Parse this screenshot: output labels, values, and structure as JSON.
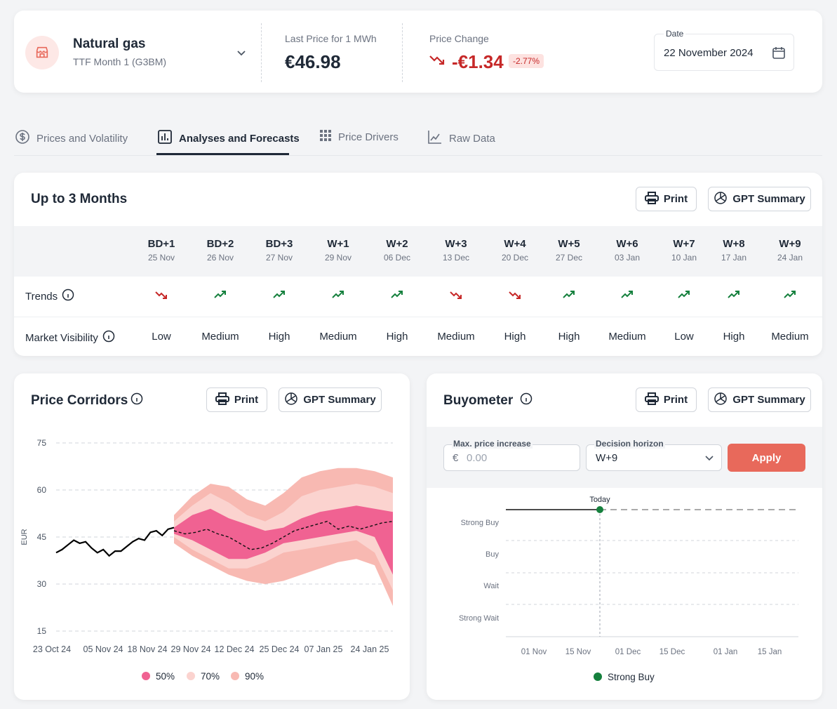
{
  "header": {
    "product_name": "Natural gas",
    "product_sub": "TTF Month 1 (G3BM)",
    "last_price_label": "Last Price for 1 MWh",
    "last_price_value": "€46.98",
    "price_change_label": "Price Change",
    "price_change_value": "-€1.34",
    "price_change_pct": "-2.77%",
    "date_label": "Date",
    "date_value": "22 November 2024"
  },
  "tabs": [
    {
      "label": "Prices and Volatility",
      "icon": "dollar-circle-icon"
    },
    {
      "label": "Analyses and Forecasts",
      "icon": "bar-chart-icon"
    },
    {
      "label": "Price Drivers",
      "icon": "grid-icon"
    },
    {
      "label": "Raw Data",
      "icon": "chart-line-icon"
    }
  ],
  "buttons": {
    "print": "Print",
    "gpt": "GPT Summary"
  },
  "months": {
    "title": "Up to 3 Months",
    "trends_label": "Trends",
    "visibility_label": "Market Visibility",
    "columns": [
      {
        "h": "BD+1",
        "d": "25 Nov",
        "trend": "down",
        "vis": "Low"
      },
      {
        "h": "BD+2",
        "d": "26 Nov",
        "trend": "up",
        "vis": "Medium"
      },
      {
        "h": "BD+3",
        "d": "27 Nov",
        "trend": "up",
        "vis": "High"
      },
      {
        "h": "W+1",
        "d": "29 Nov",
        "trend": "up",
        "vis": "Medium"
      },
      {
        "h": "W+2",
        "d": "06 Dec",
        "trend": "up",
        "vis": "High"
      },
      {
        "h": "W+3",
        "d": "13 Dec",
        "trend": "down",
        "vis": "Medium"
      },
      {
        "h": "W+4",
        "d": "20 Dec",
        "trend": "down",
        "vis": "High"
      },
      {
        "h": "W+5",
        "d": "27 Dec",
        "trend": "up",
        "vis": "High"
      },
      {
        "h": "W+6",
        "d": "03 Jan",
        "trend": "up",
        "vis": "Medium"
      },
      {
        "h": "W+7",
        "d": "10 Jan",
        "trend": "up",
        "vis": "Low"
      },
      {
        "h": "W+8",
        "d": "17 Jan",
        "trend": "up",
        "vis": "High"
      },
      {
        "h": "W+9",
        "d": "24 Jan",
        "trend": "up",
        "vis": "Medium"
      }
    ]
  },
  "corridors": {
    "title": "Price Corridors",
    "chart_data": {
      "type": "area",
      "ylabel": "EUR",
      "ylim": [
        15,
        75
      ],
      "yticks": [
        75,
        60,
        45,
        30,
        15
      ],
      "xticks": [
        "23 Oct 24",
        "05 Nov 24",
        "18 Nov 24",
        "29 Nov 24",
        "12 Dec 24",
        "25 Dec 24",
        "07 Jan 25",
        "24 Jan 25"
      ],
      "legend": [
        "50%",
        "70%",
        "90%"
      ],
      "colors": {
        "history": "#000000",
        "band50": "#f06292",
        "band70": "#fbd3cf",
        "band90": "#f8b9b2"
      },
      "history": [
        40,
        41,
        42.5,
        44,
        43,
        43.5,
        41.5,
        40,
        41,
        39,
        40.5,
        40.5,
        42,
        43.5,
        44.5,
        44,
        46.5,
        47,
        45.5,
        47.5,
        48
      ],
      "forecast_median": [
        47,
        46,
        46.5,
        47.5,
        46,
        45,
        43,
        41,
        41.5,
        43,
        45,
        47,
        48,
        49,
        50,
        47.5,
        48.5,
        47.5,
        48.5,
        49.5,
        50
      ],
      "band50": {
        "upper": [
          48,
          52,
          54,
          51,
          49,
          47,
          48,
          51,
          53,
          54,
          55,
          54,
          53
        ],
        "lower": [
          46,
          44,
          41,
          38,
          38,
          40,
          43,
          44,
          45,
          46,
          47,
          45,
          33
        ]
      },
      "band70": {
        "upper": [
          50,
          55,
          59,
          56,
          52,
          50,
          53,
          58,
          60,
          61,
          62,
          61,
          59
        ],
        "lower": [
          45,
          41,
          38,
          35,
          35,
          37,
          40,
          41,
          42,
          43,
          44,
          40,
          28
        ]
      },
      "band90": {
        "upper": [
          52,
          58,
          62,
          61,
          57,
          55,
          59,
          64,
          66,
          67,
          67,
          66,
          64
        ],
        "lower": [
          43,
          39,
          36,
          33,
          31,
          30,
          31,
          33,
          35,
          37,
          38,
          36,
          23
        ]
      }
    }
  },
  "buyometer": {
    "title": "Buyometer",
    "max_label": "Max. price increase",
    "max_currency": "€",
    "max_placeholder": "0.00",
    "horizon_label": "Decision horizon",
    "horizon_value": "W+9",
    "apply": "Apply",
    "chart_data": {
      "type": "scatter",
      "ylabels": [
        "Strong Buy",
        "Buy",
        "Wait",
        "Strong Wait"
      ],
      "xticks": [
        "01 Nov",
        "15 Nov",
        "01 Dec",
        "15 Dec",
        "01 Jan",
        "15 Jan"
      ],
      "today_label": "Today",
      "points": [
        {
          "x": "Today",
          "y": "Strong Buy",
          "color": "#15803d"
        }
      ],
      "legend": [
        "Strong Buy"
      ]
    }
  }
}
